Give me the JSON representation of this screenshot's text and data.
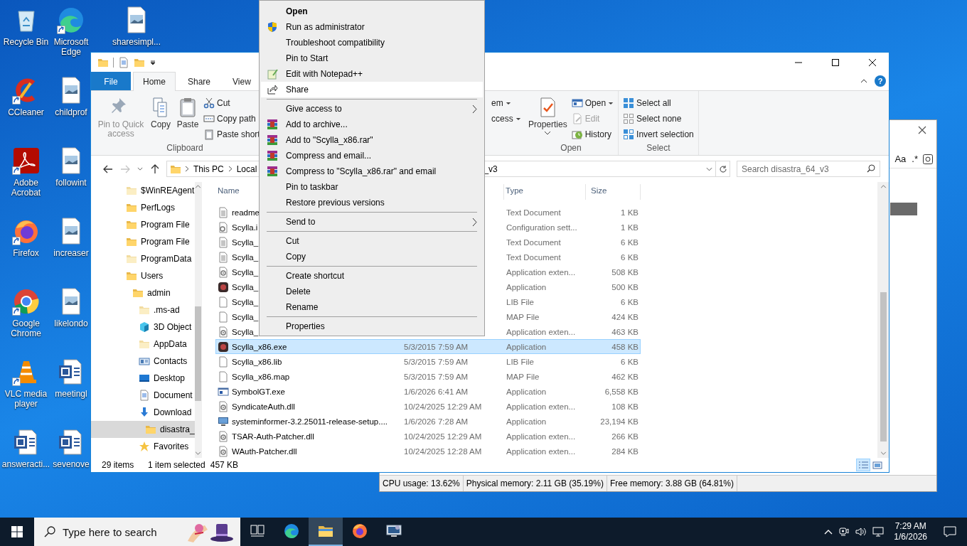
{
  "desktop": {
    "icons": [
      {
        "label": "Recycle Bin",
        "kind": "recycle",
        "shortcut": false
      },
      {
        "label": "CCleaner",
        "kind": "ccleaner",
        "shortcut": true
      },
      {
        "label": "Adobe Acrobat",
        "kind": "acrobat",
        "shortcut": true
      },
      {
        "label": "Firefox",
        "kind": "firefox",
        "shortcut": true
      },
      {
        "label": "Google Chrome",
        "kind": "chrome",
        "shortcut": true
      },
      {
        "label": "VLC media player",
        "kind": "vlc",
        "shortcut": true
      },
      {
        "label": "answeracti...",
        "kind": "word",
        "shortcut": false
      },
      {
        "label": "Microsoft Edge",
        "kind": "edge",
        "shortcut": true
      },
      {
        "label": "childprof",
        "kind": "image",
        "shortcut": false
      },
      {
        "label": "followint",
        "kind": "image",
        "shortcut": false
      },
      {
        "label": "increaser",
        "kind": "image",
        "shortcut": false
      },
      {
        "label": "likelondo",
        "kind": "image",
        "shortcut": false
      },
      {
        "label": "meetingl",
        "kind": "word",
        "shortcut": false
      },
      {
        "label": "sevenove",
        "kind": "word",
        "shortcut": false
      },
      {
        "label": "sharesimpl...",
        "kind": "image",
        "shortcut": false
      }
    ]
  },
  "back_window": {
    "search_options": [
      "Aa",
      ".*"
    ],
    "status_bar": [
      "CPU usage: 13.62%",
      "Physical memory: 2.11 GB (35.19%)",
      "Free memory: 3.88 GB (64.81%)"
    ]
  },
  "explorer": {
    "ribbon_tabs": [
      {
        "label": "File",
        "kind": "file",
        "selected": false
      },
      {
        "label": "Home",
        "kind": "tab",
        "selected": true
      },
      {
        "label": "Share",
        "kind": "tab",
        "selected": false
      },
      {
        "label": "View",
        "kind": "tab",
        "selected": false
      }
    ],
    "help": "?",
    "ribbon_groups": [
      {
        "label": "Clipboard",
        "large": [
          {
            "label": "Pin to Quick access",
            "kind": "pin",
            "disabled": true,
            "dropdown": false
          },
          {
            "label": "Copy",
            "kind": "copy",
            "disabled": false,
            "dropdown": false
          },
          {
            "label": "Paste",
            "kind": "paste",
            "disabled": false,
            "dropdown": false
          }
        ],
        "small": [
          {
            "label": "Cut",
            "kind": "cut",
            "disabled": false,
            "dropdown": false
          },
          {
            "label": "Copy path",
            "kind": "copypath",
            "disabled": false,
            "dropdown": false
          },
          {
            "label": "Paste short",
            "kind": "pasteshortcut",
            "disabled": false,
            "dropdown": false
          }
        ]
      },
      {
        "small": [
          {
            "label": "em",
            "kind": "none",
            "disabled": false,
            "dropdown": true
          },
          {
            "label": "ccess",
            "kind": "none",
            "disabled": false,
            "dropdown": true
          }
        ]
      },
      {
        "label": "Open",
        "large": [
          {
            "label": "Properties",
            "kind": "props",
            "disabled": false,
            "dropdown": true
          }
        ],
        "small": [
          {
            "label": "Open",
            "kind": "open",
            "disabled": false,
            "dropdown": true
          },
          {
            "label": "Edit",
            "kind": "edit",
            "disabled": true,
            "dropdown": false
          },
          {
            "label": "History",
            "kind": "history",
            "disabled": false,
            "dropdown": false
          }
        ]
      },
      {
        "label": "Select",
        "small": [
          {
            "label": "Select all",
            "kind": "selectall",
            "disabled": false,
            "dropdown": false
          },
          {
            "label": "Select none",
            "kind": "selectnone",
            "disabled": false,
            "dropdown": false
          },
          {
            "label": "Invert selection",
            "kind": "invert",
            "disabled": false,
            "dropdown": false
          }
        ]
      }
    ],
    "address": {
      "path": [
        "This PC",
        "Local"
      ],
      "tail": "_v3",
      "search_placeholder": "Search disastra_64_v3"
    },
    "nav": [
      {
        "label": "$WinREAgent",
        "kind": "folder-pale",
        "selected": false
      },
      {
        "label": "PerfLogs",
        "kind": "folder",
        "selected": false
      },
      {
        "label": "Program File",
        "kind": "folder",
        "selected": false
      },
      {
        "label": "Program File",
        "kind": "folder",
        "selected": false
      },
      {
        "label": "ProgramData",
        "kind": "folder-pale",
        "selected": false
      },
      {
        "label": "Users",
        "kind": "folder",
        "selected": false,
        "children": [
          {
            "label": "admin",
            "kind": "folder",
            "selected": false,
            "children": [
              {
                "label": ".ms-ad",
                "kind": "folder-pale",
                "selected": false
              },
              {
                "label": "3D Object",
                "kind": "cube",
                "selected": false
              },
              {
                "label": "AppData",
                "kind": "folder-pale",
                "selected": false
              },
              {
                "label": "Contacts",
                "kind": "contacts",
                "selected": false
              },
              {
                "label": "Desktop",
                "kind": "desktop",
                "selected": false
              },
              {
                "label": "Document",
                "kind": "documents",
                "selected": false
              },
              {
                "label": "Download",
                "kind": "downloads",
                "selected": false,
                "children": [
                  {
                    "label": "disastra_",
                    "kind": "folder",
                    "selected": true
                  }
                ]
              },
              {
                "label": "Favorites",
                "kind": "star",
                "selected": false
              }
            ]
          }
        ]
      }
    ],
    "columns": [
      "Name",
      "Type",
      "Size"
    ],
    "files": [
      {
        "name": "readme",
        "type": "Text Document",
        "size": "1 KB",
        "kind": "text",
        "selected": false
      },
      {
        "name": "Scylla.i",
        "type": "Configuration sett...",
        "size": "1 KB",
        "kind": "config",
        "selected": false
      },
      {
        "name": "Scylla_",
        "type": "Text Document",
        "size": "6 KB",
        "kind": "text",
        "selected": false
      },
      {
        "name": "Scylla_",
        "type": "Text Document",
        "size": "6 KB",
        "kind": "text",
        "selected": false
      },
      {
        "name": "Scylla_",
        "type": "Application exten...",
        "size": "508 KB",
        "kind": "dll",
        "selected": false
      },
      {
        "name": "Scylla_",
        "type": "Application",
        "size": "500 KB",
        "kind": "app",
        "selected": false
      },
      {
        "name": "Scylla_",
        "type": "LIB File",
        "size": "6 KB",
        "kind": "blank",
        "selected": false
      },
      {
        "name": "Scylla_",
        "type": "MAP File",
        "size": "424 KB",
        "kind": "blank",
        "selected": false
      },
      {
        "name": "Scylla_",
        "type": "Application exten...",
        "size": "463 KB",
        "kind": "dll",
        "selected": false
      },
      {
        "name": "Scylla_x86.exe",
        "date": "5/3/2015 7:59 AM",
        "type": "Application",
        "size": "458 KB",
        "kind": "app",
        "selected": true
      },
      {
        "name": "Scylla_x86.lib",
        "date": "5/3/2015 7:59 AM",
        "type": "LIB File",
        "size": "6 KB",
        "kind": "blank",
        "selected": false
      },
      {
        "name": "Scylla_x86.map",
        "date": "5/3/2015 7:59 AM",
        "type": "MAP File",
        "size": "462 KB",
        "kind": "blank",
        "selected": false
      },
      {
        "name": "SymbolGT.exe",
        "date": "1/6/2026 6:41 AM",
        "type": "Application",
        "size": "6,558 KB",
        "kind": "window",
        "selected": false
      },
      {
        "name": "SyndicateAuth.dll",
        "date": "10/24/2025 12:29 AM",
        "type": "Application exten...",
        "size": "108 KB",
        "kind": "dll",
        "selected": false
      },
      {
        "name": "systeminformer-3.2.25011-release-setup....",
        "date": "1/6/2026 7:28 AM",
        "type": "Application",
        "size": "23,194 KB",
        "kind": "installer",
        "selected": false
      },
      {
        "name": "TSAR-Auth-Patcher.dll",
        "date": "10/24/2025 12:29 AM",
        "type": "Application exten...",
        "size": "266 KB",
        "kind": "dll",
        "selected": false
      },
      {
        "name": "WAuth-Patcher.dll",
        "date": "10/24/2025 12:28 AM",
        "type": "Application exten...",
        "size": "284 KB",
        "kind": "dll",
        "selected": false
      }
    ],
    "status": {
      "count": "29 items",
      "selection": "1 item selected",
      "size": "457 KB"
    },
    "view_buttons": [
      {
        "kind": "details",
        "selected": true
      },
      {
        "kind": "tiles",
        "selected": false
      }
    ]
  },
  "context_menu": {
    "items": [
      {
        "kind": "plain",
        "label": "Open",
        "default": true,
        "submenu": false,
        "selected": false
      },
      {
        "kind": "shield",
        "label": "Run as administrator",
        "default": false,
        "submenu": false,
        "selected": false
      },
      {
        "kind": "plain",
        "label": "Troubleshoot compatibility",
        "default": false,
        "submenu": false,
        "selected": false
      },
      {
        "kind": "plain",
        "label": "Pin to Start",
        "default": false,
        "submenu": false,
        "selected": false
      },
      {
        "kind": "notepad",
        "label": "Edit with Notepad++",
        "default": false,
        "submenu": false,
        "selected": false
      },
      {
        "kind": "share",
        "label": "Share",
        "default": false,
        "submenu": false,
        "selected": true
      },
      {
        "kind": "separator"
      },
      {
        "kind": "plain",
        "label": "Give access to",
        "default": false,
        "submenu": true,
        "selected": false
      },
      {
        "kind": "archive",
        "label": "Add to archive...",
        "default": false,
        "submenu": false,
        "selected": false
      },
      {
        "kind": "archive",
        "label": "Add to \"Scylla_x86.rar\"",
        "default": false,
        "submenu": false,
        "selected": false
      },
      {
        "kind": "archive",
        "label": "Compress and email...",
        "default": false,
        "submenu": false,
        "selected": false
      },
      {
        "kind": "archive",
        "label": "Compress to \"Scylla_x86.rar\" and email",
        "default": false,
        "submenu": false,
        "selected": false
      },
      {
        "kind": "plain",
        "label": "Pin to taskbar",
        "default": false,
        "submenu": false,
        "selected": false
      },
      {
        "kind": "plain",
        "label": "Restore previous versions",
        "default": false,
        "submenu": false,
        "selected": false
      },
      {
        "kind": "separator"
      },
      {
        "kind": "plain",
        "label": "Send to",
        "default": false,
        "submenu": true,
        "selected": false
      },
      {
        "kind": "separator"
      },
      {
        "kind": "plain",
        "label": "Cut",
        "default": false,
        "submenu": false,
        "selected": false
      },
      {
        "kind": "plain",
        "label": "Copy",
        "default": false,
        "submenu": false,
        "selected": false
      },
      {
        "kind": "separator"
      },
      {
        "kind": "plain",
        "label": "Create shortcut",
        "default": false,
        "submenu": false,
        "selected": false
      },
      {
        "kind": "plain",
        "label": "Delete",
        "default": false,
        "submenu": false,
        "selected": false
      },
      {
        "kind": "plain",
        "label": "Rename",
        "default": false,
        "submenu": false,
        "selected": false
      },
      {
        "kind": "separator"
      },
      {
        "kind": "plain",
        "label": "Properties",
        "default": false,
        "submenu": false,
        "selected": false
      }
    ]
  },
  "taskbar": {
    "search_placeholder": "Type here to search",
    "apps": [
      {
        "kind": "taskview",
        "selected": false
      },
      {
        "kind": "edge",
        "selected": false
      },
      {
        "kind": "explorer",
        "selected": true
      },
      {
        "kind": "firefox",
        "selected": false
      },
      {
        "kind": "sysinfo",
        "selected": false
      }
    ],
    "clock": {
      "time": "7:29 AM",
      "date": "1/6/2026"
    }
  }
}
